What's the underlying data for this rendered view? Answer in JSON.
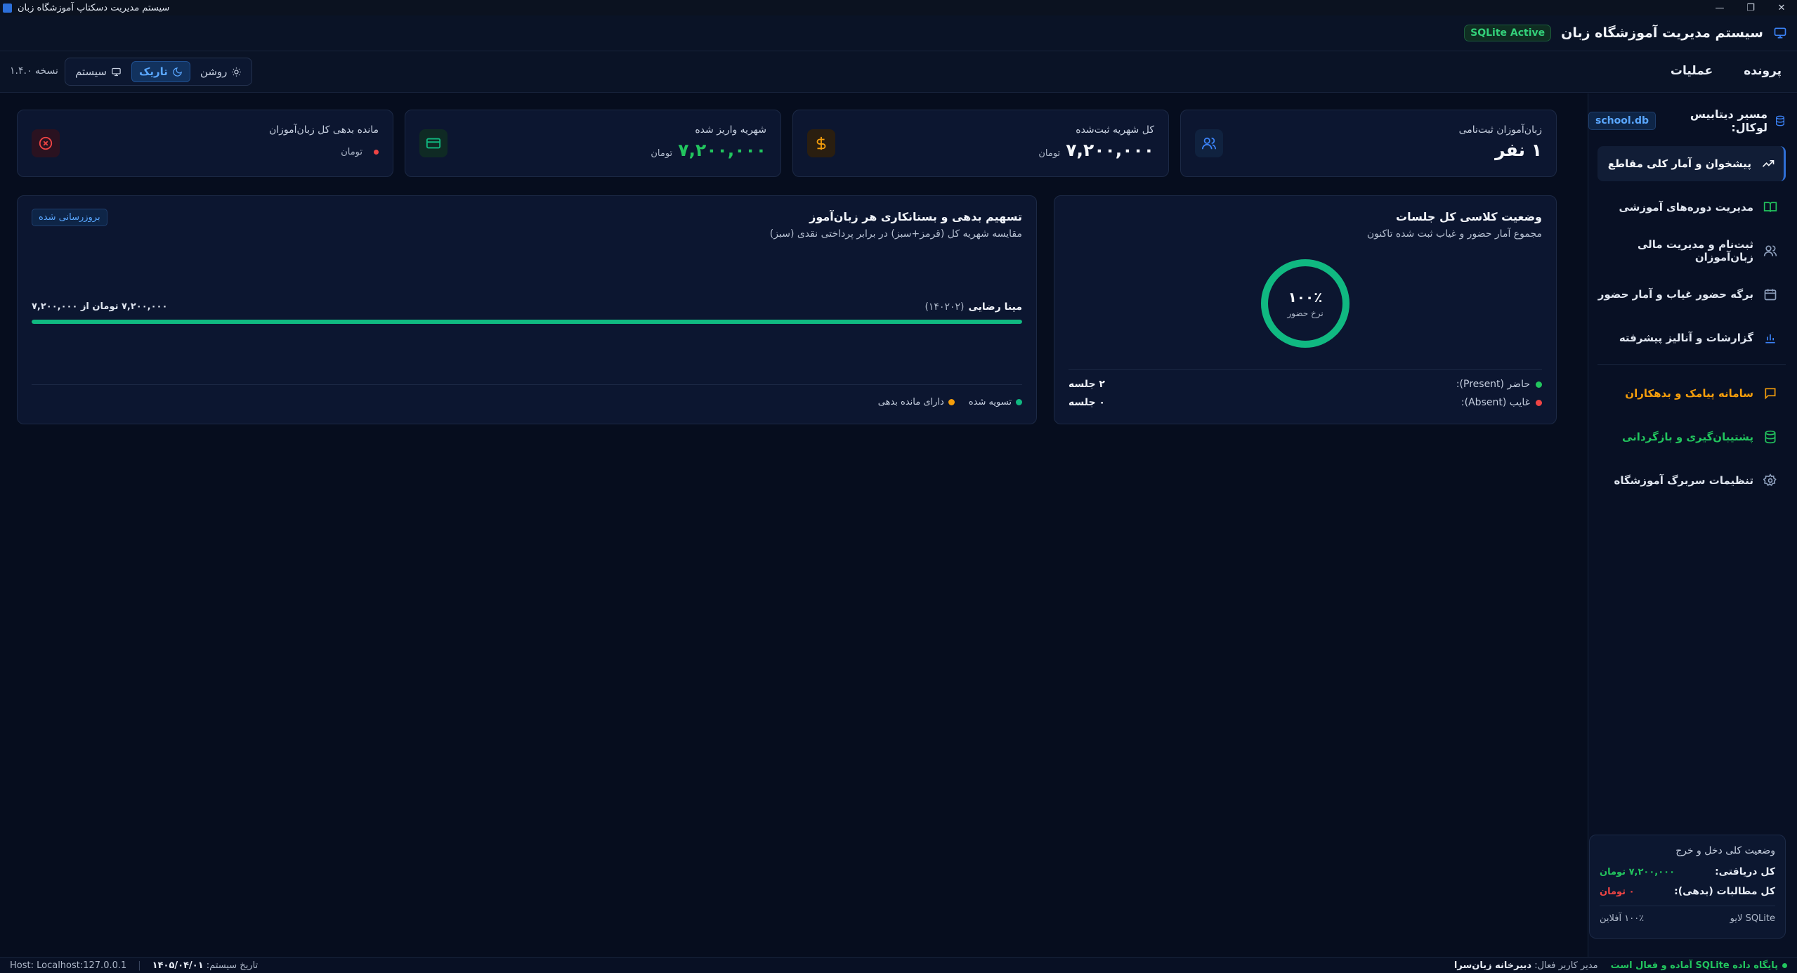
{
  "window": {
    "title": "سیستم مدیریت دسکتاپ آموزشگاه زبان"
  },
  "header": {
    "app_name": "سیستم مدیریت آموزشگاه زبان",
    "db_badge": "SQLite Active"
  },
  "menubar": {
    "menus": [
      "پرونده",
      "عملیات"
    ],
    "theme": {
      "light": "روشن",
      "dark": "تاریک",
      "system": "سیستم"
    },
    "version": "نسخه ۱.۴.۰"
  },
  "sidebar": {
    "db_label": "مسیر دیتابیس لوکال:",
    "db_file": "school.db",
    "nav": [
      "پیشخوان و آمار کلی مقاطع",
      "مدیریت دوره‌های آموزشی",
      "ثبت‌نام و مدیریت مالی زبان‌آموزان",
      "برگه حضور غیاب و آمار حضور",
      "گزارشات و آنالیز پیشرفته",
      "سامانه پیامک و بدهکاران",
      "پشتیبان‌گیری و بازگردانی",
      "تنظیمات سربرگ آموزشگاه"
    ],
    "finance": {
      "title": "وضعیت کلی دخل و خرج",
      "received_label": "کل دریافتی:",
      "received_value": "۷,۲۰۰,۰۰۰ تومان",
      "debt_label": "کل مطالبات (بدهی):",
      "debt_value": "۰ تومان",
      "footer_left": "SQLite لایو",
      "footer_right": "۱۰۰٪ آفلاین"
    }
  },
  "stats": [
    {
      "label": "زبان‌آموزان ثبت‌نامی",
      "value": "۱ نفر",
      "unit": ""
    },
    {
      "label": "کل شهریه ثبت‌شده",
      "value": "۷,۲۰۰,۰۰۰",
      "unit": "تومان"
    },
    {
      "label": "شهریه واریز شده",
      "value": "۷,۲۰۰,۰۰۰",
      "unit": "تومان"
    },
    {
      "label": "مانده بدهی کل زبان‌آموزان",
      "value": "",
      "unit": "تومان"
    }
  ],
  "attendance": {
    "title": "وضعیت کلاسی کل جلسات",
    "subtitle": "مجموع آمار حضور و غیاب ثبت شده تاکنون",
    "rate": 1.0,
    "rate_text": "۱۰۰٪",
    "rate_label": "نرخ حضور",
    "present_label": "حاضر (Present):",
    "present_value": "۲ جلسه",
    "absent_label": "غایب (Absent):",
    "absent_value": "۰ جلسه"
  },
  "debts": {
    "title": "تسهیم بدهی و بستانکاری هر زبان‌آموز",
    "subtitle": "مقایسه شهریه کل (قرمز+سبز) در برابر پرداختی نقدی (سبز)",
    "refresh_label": "بروزرسانی شده",
    "student": {
      "name": "مینا رضایی",
      "code": "(۱۴۰۲۰۲)",
      "amount": "۷,۲۰۰,۰۰۰ تومان از ۷,۲۰۰,۰۰۰",
      "paid_fraction": 1.0
    },
    "legend_settled": "تسویه شده",
    "legend_debt": "دارای مانده بدهی"
  },
  "statusbar": {
    "db_ok": "پایگاه داده SQLite آماده و فعال است",
    "user_label": "مدیر کاربر فعال:",
    "user_value": "دبیرخانه زبان‌سرا",
    "date_label": "تاریخ سیستم:",
    "date_value": "۱۴۰۵/۰۴/۰۱",
    "host": "Host: Localhost:127.0.0.1"
  },
  "colors": {
    "accent": "#3b82f6",
    "green": "#22c55e",
    "red": "#ef4444",
    "orange": "#f59e0b",
    "bg": "#060d1e"
  }
}
